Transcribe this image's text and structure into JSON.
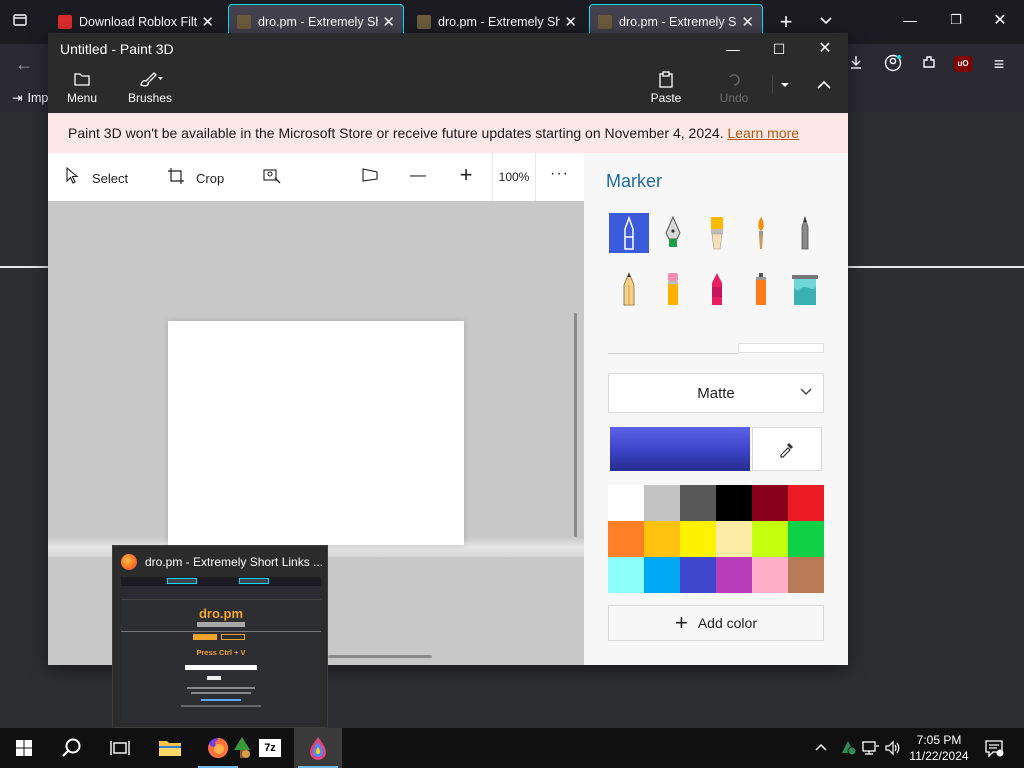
{
  "firefox": {
    "tabs": [
      {
        "title": "Download Roblox Filte",
        "fav_color": "#d92d2d",
        "selected": false
      },
      {
        "title": "dro.pm - Extremely Sho",
        "fav_color": "#6b5a3c",
        "selected": true
      },
      {
        "title": "dro.pm - Extremely Sho",
        "fav_color": "#6b5a3c",
        "selected": false
      },
      {
        "title": "dro.pm - Extremely Sho",
        "fav_color": "#6b5a3c",
        "selected": true
      }
    ],
    "new_tab_label": "+",
    "bookmark_label": "Imp"
  },
  "paint3d": {
    "title": "Untitled - Paint 3D",
    "toolbar": {
      "menu_label": "Menu",
      "brushes_label": "Brushes",
      "paste_label": "Paste",
      "undo_label": "Undo"
    },
    "banner": {
      "text": "Paint 3D won't be available in the Microsoft Store or receive future updates starting on November 4, 2024.",
      "link": "Learn more"
    },
    "canvas_tools": {
      "select_label": "Select",
      "crop_label": "Crop",
      "zoom": "100%",
      "more_label": "···"
    },
    "panel": {
      "title": "Marker",
      "brushes": [
        "marker",
        "calligraphy-pen",
        "oil-brush",
        "watercolor",
        "pixel-pen",
        "pencil",
        "eraser",
        "crayon",
        "spray-can",
        "fill"
      ],
      "selected_brush": "marker",
      "finish": "Matte",
      "current_color": "#4a52d8",
      "palette": [
        "#ffffff",
        "#c3c3c3",
        "#585858",
        "#000000",
        "#88001b",
        "#ec1c24",
        "#ff7f27",
        "#ffc20e",
        "#fff200",
        "#fdeca6",
        "#c4ff0e",
        "#0ed145",
        "#8cfffb",
        "#00a8f3",
        "#3f48cc",
        "#b83dba",
        "#ffaec8",
        "#b97a56"
      ],
      "add_color_label": "Add color"
    }
  },
  "preview": {
    "title": "dro.pm - Extremely Short Links ...",
    "site_logo": "dro.pm",
    "press_text": "Press Ctrl + V"
  },
  "taskbar": {
    "time": "7:05 PM",
    "date": "11/22/2024",
    "apps": [
      "file-explorer",
      "firefox",
      "tree-app",
      "7zip",
      "paint3d"
    ]
  }
}
